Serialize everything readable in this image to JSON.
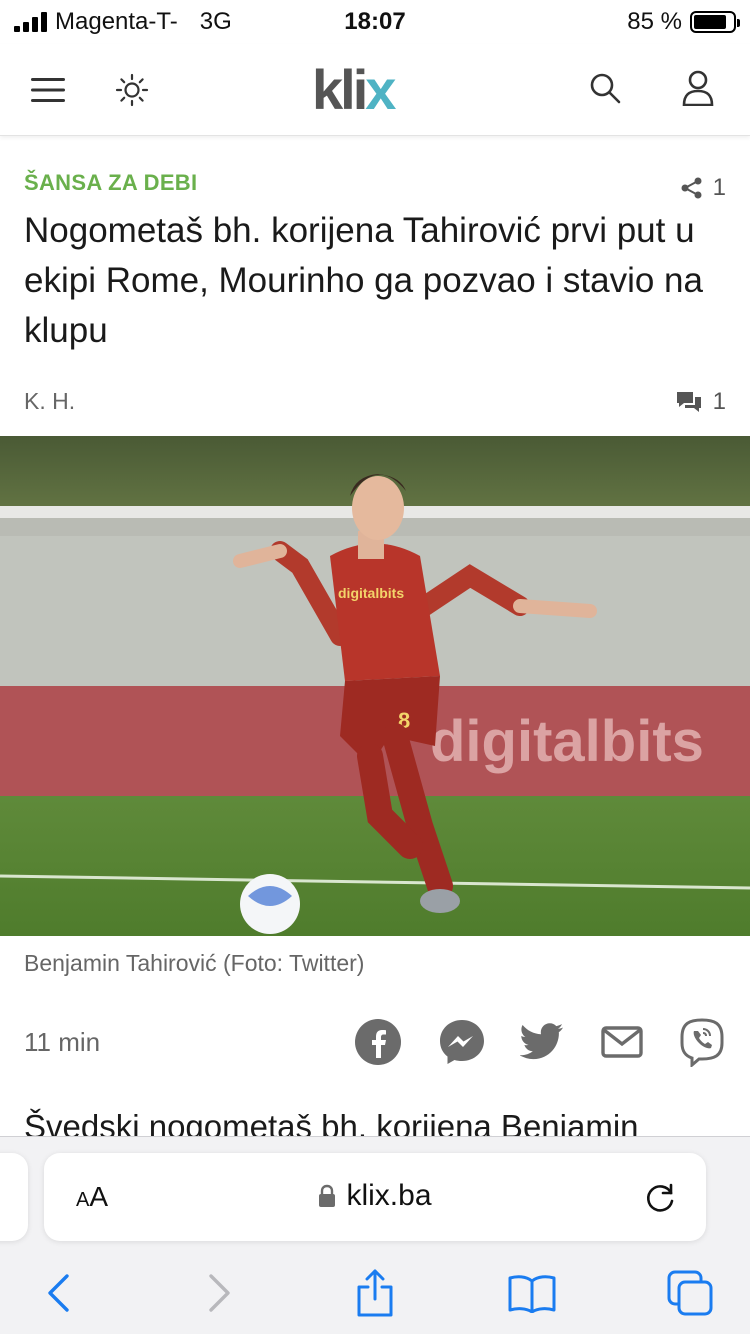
{
  "status_bar": {
    "carrier": "Magenta-T-",
    "network": "3G",
    "time": "18:07",
    "battery": "85 %",
    "battery_level": 0.85
  },
  "header": {
    "logo_text": "kli",
    "logo_x": "x",
    "icons": [
      "menu-icon",
      "brightness-icon",
      "search-icon",
      "user-icon"
    ],
    "logo_colors": {
      "text": "#555555",
      "x": "#4fb3c4"
    }
  },
  "article": {
    "category": "ŠANSA ZA DEBI",
    "category_color": "#6ab04c",
    "share_count": "1",
    "headline": "Nogometaš bh. korijena Tahirović prvi put u ekipi Rome, Mourinho ga pozvao i stavio na klupu",
    "author": "K. H.",
    "comment_count": "1",
    "photo_caption": "Benjamin Tahirović (Foto: Twitter)",
    "photo_jersey_text": "digitalbits",
    "photo_jersey_number": "8",
    "photo_board_text": "digitalbits",
    "time_ago": "11 min",
    "share_buttons": [
      "facebook-icon",
      "messenger-icon",
      "twitter-icon",
      "mail-icon",
      "viber-icon"
    ],
    "teaser": "Švedski nogometaš bh. korijena Benjamin"
  },
  "safari": {
    "aa_label_small": "A",
    "aa_label_big": "A",
    "url": "klix.ba",
    "toolbar": [
      "back-icon",
      "forward-icon",
      "share-icon",
      "bookmarks-icon",
      "tabs-icon"
    ]
  }
}
